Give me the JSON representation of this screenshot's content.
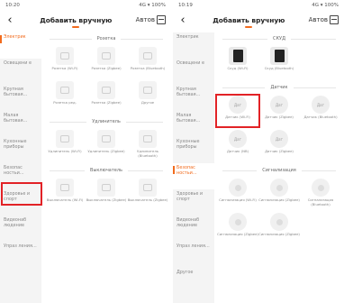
{
  "screen1": {
    "status": {
      "time": "10:20",
      "icons": "4G ▾ 100%"
    },
    "header": {
      "back": "‹",
      "title": "Добавить вручную",
      "right": "Автов"
    },
    "sidebar": [
      "Электрик",
      "Освещени е",
      "Крупная бытовая…",
      "Малая бытовая…",
      "Кухонные приборы",
      "Безопас ностьи…",
      "Здоровье и спорт",
      "Видеонаб людение",
      "Упраз ления…"
    ],
    "active_index": 0,
    "sections": [
      {
        "title": "Розетка",
        "items": [
          {
            "label": "Розетка (Wi-Fi)"
          },
          {
            "label": "Розетка (Zigbee)"
          },
          {
            "label": "Розетка (Bluetooth)"
          },
          {
            "label": "Розетка ред."
          },
          {
            "label": "Розетка (Zigbee)"
          },
          {
            "label": "Другое"
          }
        ]
      },
      {
        "title": "Удлинитель",
        "items": [
          {
            "label": "Удлинитель (Wi-Fi)"
          },
          {
            "label": "Удлинитель (Zigbee)"
          },
          {
            "label": "Удлинитель (Bluetooth)"
          }
        ]
      },
      {
        "title": "Выключатель",
        "items": [
          {
            "label": "Выключатель (Wi-Fi)"
          },
          {
            "label": "Выключатель (Zigbee)"
          },
          {
            "label": "Выключатель (Zigbee)"
          }
        ]
      }
    ]
  },
  "screen2": {
    "status": {
      "time": "10:19",
      "icons": "4G ▾ 100%"
    },
    "header": {
      "back": "‹",
      "title": "Добавить вручную",
      "right": "Автов"
    },
    "sidebar": [
      "Электрик",
      "Освещени е",
      "Крупная бытовая…",
      "Малая бытовая…",
      "Кухонные приборы",
      "Безопас ностьи…",
      "Здоровье и спорт",
      "Видеонаб людение",
      "Упраз ления…",
      "Другое"
    ],
    "active_index": 5,
    "sections": [
      {
        "title": "СКУД",
        "items": [
          {
            "label": "Скуд (Wi-Fi)",
            "kind": "dark"
          },
          {
            "label": "Скуд (Bluetooth)",
            "kind": "dark"
          }
        ]
      },
      {
        "title": "Датчик",
        "items": [
          {
            "label": "Датчик (Wi-Fi)",
            "kind": "round",
            "glyph": "Дат"
          },
          {
            "label": "Датчик (Zigbee)",
            "kind": "round",
            "glyph": "Дат"
          },
          {
            "label": "Датчик (Bluetooth)",
            "kind": "round",
            "glyph": "Дат"
          },
          {
            "label": "Датчик (NB)",
            "kind": "round",
            "glyph": "Дат"
          },
          {
            "label": "Датчик (Zigbee)",
            "kind": "round",
            "glyph": "Дат"
          }
        ]
      },
      {
        "title": "Сигнализация",
        "items": [
          {
            "label": "Сигнализация (Wi-Fi)",
            "kind": "bulb"
          },
          {
            "label": "Сигнализация (Zigbee)",
            "kind": "bulb"
          },
          {
            "label": "Сигнализация (Bluetooth)",
            "kind": "bulb"
          },
          {
            "label": "Сигнализация (Zigbee)",
            "kind": "bulb"
          },
          {
            "label": "Сигнализация (Zigbee)",
            "kind": "bulb"
          }
        ]
      }
    ]
  },
  "colors": {
    "accent": "#f26b1d",
    "highlight": "#e22226",
    "sidebar_bg": "#f4f4f4"
  }
}
